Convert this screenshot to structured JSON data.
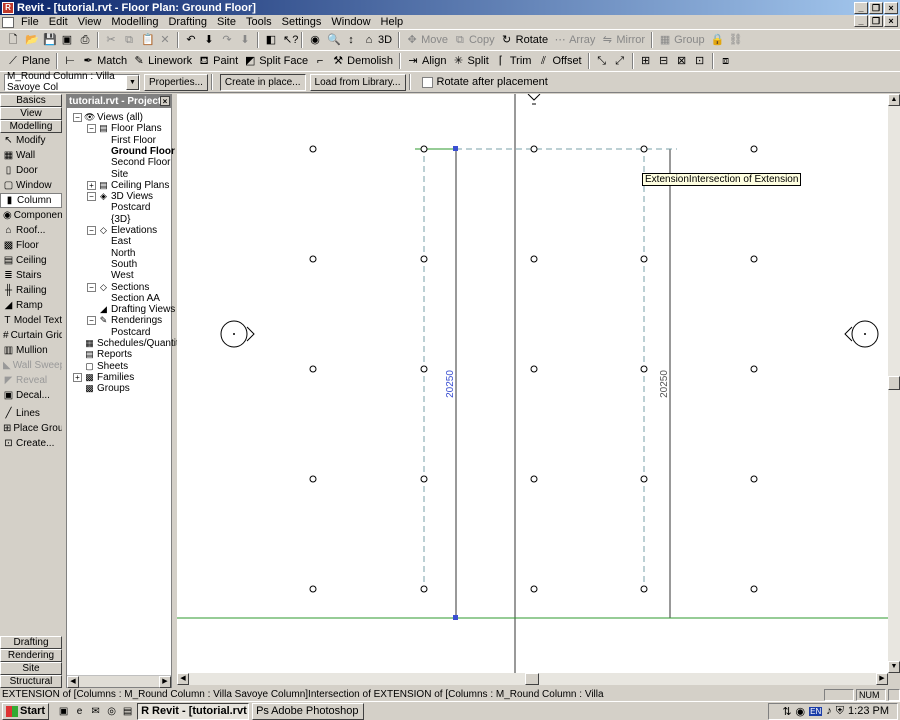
{
  "window": {
    "title": "Revit - [tutorial.rvt - Floor Plan: Ground Floor]",
    "min": "_",
    "max": "□",
    "close": "×",
    "restore": "❐"
  },
  "menu": [
    "File",
    "Edit",
    "View",
    "Modelling",
    "Drafting",
    "Site",
    "Tools",
    "Settings",
    "Window",
    "Help"
  ],
  "toolbar1": {
    "move": "Move",
    "copy": "Copy",
    "rotate": "Rotate",
    "array": "Array",
    "mirror": "Mirror",
    "group": "Group",
    "threed": "3D"
  },
  "toolbar2": {
    "plane": "Plane",
    "match": "Match",
    "linework": "Linework",
    "paint": "Paint",
    "split_face": "Split Face",
    "demolish": "Demolish",
    "align": "Align",
    "split": "Split",
    "trim": "Trim",
    "offset": "Offset"
  },
  "options_bar": {
    "type_selector": "M_Round Column : Villa Savoye Col",
    "properties": "Properties...",
    "create_in_place": "Create in place...",
    "load_from_library": "Load from Library...",
    "rotate_after_placement": "Rotate after placement"
  },
  "design_bar": {
    "tabs_top": [
      "Basics",
      "View",
      "Modelling"
    ],
    "items": [
      {
        "label": "Modify",
        "icon": "↖",
        "dim": false,
        "selected": false
      },
      {
        "label": "Wall",
        "icon": "▦",
        "dim": false,
        "selected": false
      },
      {
        "label": "Door",
        "icon": "▯",
        "dim": false,
        "selected": false
      },
      {
        "label": "Window",
        "icon": "▢",
        "dim": false,
        "selected": false
      },
      {
        "label": "Column",
        "icon": "▮",
        "dim": false,
        "selected": true
      },
      {
        "label": "Component",
        "icon": "◉",
        "dim": false,
        "selected": false
      },
      {
        "label": "Roof...",
        "icon": "⌂",
        "dim": false,
        "selected": false
      },
      {
        "label": "Floor",
        "icon": "▩",
        "dim": false,
        "selected": false
      },
      {
        "label": "Ceiling",
        "icon": "▤",
        "dim": false,
        "selected": false
      },
      {
        "label": "Stairs",
        "icon": "≣",
        "dim": false,
        "selected": false
      },
      {
        "label": "Railing",
        "icon": "╫",
        "dim": false,
        "selected": false
      },
      {
        "label": "Ramp",
        "icon": "◢",
        "dim": false,
        "selected": false
      },
      {
        "label": "Model Text",
        "icon": "T",
        "dim": false,
        "selected": false
      },
      {
        "label": "Curtain Grid",
        "icon": "#",
        "dim": false,
        "selected": false
      },
      {
        "label": "Mullion",
        "icon": "▥",
        "dim": false,
        "selected": false
      },
      {
        "label": "Wall Sweep",
        "icon": "◣",
        "dim": true,
        "selected": false
      },
      {
        "label": "Reveal",
        "icon": "◤",
        "dim": true,
        "selected": false
      },
      {
        "label": "Decal...",
        "icon": "▣",
        "dim": false,
        "selected": false
      },
      {
        "label": "Lines",
        "icon": "╱",
        "dim": false,
        "selected": false
      },
      {
        "label": "Place Group",
        "icon": "⊞",
        "dim": false,
        "selected": false
      },
      {
        "label": "Create...",
        "icon": "⊡",
        "dim": false,
        "selected": false
      }
    ],
    "tabs_bottom": [
      "Drafting",
      "Rendering",
      "Site",
      "Structural"
    ]
  },
  "project_browser": {
    "title": "tutorial.rvt - Project ...",
    "close": "×",
    "nodes": [
      {
        "label": "Views (all)",
        "level": 0,
        "pm": "−",
        "icon": "👁",
        "bold": false
      },
      {
        "label": "Floor Plans",
        "level": 1,
        "pm": "−",
        "icon": "▤",
        "bold": false
      },
      {
        "label": "First Floor",
        "level": 2,
        "pm": "",
        "icon": "",
        "bold": false
      },
      {
        "label": "Ground Floor",
        "level": 2,
        "pm": "",
        "icon": "",
        "bold": true
      },
      {
        "label": "Second Floor",
        "level": 2,
        "pm": "",
        "icon": "",
        "bold": false
      },
      {
        "label": "Site",
        "level": 2,
        "pm": "",
        "icon": "",
        "bold": false
      },
      {
        "label": "Ceiling Plans",
        "level": 1,
        "pm": "+",
        "icon": "▤",
        "bold": false
      },
      {
        "label": "3D Views",
        "level": 1,
        "pm": "−",
        "icon": "◈",
        "bold": false
      },
      {
        "label": "Postcard",
        "level": 2,
        "pm": "",
        "icon": "",
        "bold": false
      },
      {
        "label": "{3D}",
        "level": 2,
        "pm": "",
        "icon": "",
        "bold": false
      },
      {
        "label": "Elevations",
        "level": 1,
        "pm": "−",
        "icon": "◇",
        "bold": false
      },
      {
        "label": "East",
        "level": 2,
        "pm": "",
        "icon": "",
        "bold": false
      },
      {
        "label": "North",
        "level": 2,
        "pm": "",
        "icon": "",
        "bold": false
      },
      {
        "label": "South",
        "level": 2,
        "pm": "",
        "icon": "",
        "bold": false
      },
      {
        "label": "West",
        "level": 2,
        "pm": "",
        "icon": "",
        "bold": false
      },
      {
        "label": "Sections",
        "level": 1,
        "pm": "−",
        "icon": "◇",
        "bold": false
      },
      {
        "label": "Section AA",
        "level": 2,
        "pm": "",
        "icon": "",
        "bold": false
      },
      {
        "label": "Drafting Views",
        "level": 1,
        "pm": "",
        "icon": "◢",
        "bold": false
      },
      {
        "label": "Renderings",
        "level": 1,
        "pm": "−",
        "icon": "✎",
        "bold": false
      },
      {
        "label": "Postcard",
        "level": 2,
        "pm": "",
        "icon": "",
        "bold": false
      },
      {
        "label": "Schedules/Quantities",
        "level": 0,
        "pm": "",
        "icon": "▦",
        "bold": false
      },
      {
        "label": "Reports",
        "level": 0,
        "pm": "",
        "icon": "▤",
        "bold": false
      },
      {
        "label": "Sheets",
        "level": 0,
        "pm": "",
        "icon": "▢",
        "bold": false
      },
      {
        "label": "Families",
        "level": 0,
        "pm": "+",
        "icon": "▩",
        "bold": false
      },
      {
        "label": "Groups",
        "level": 0,
        "pm": "",
        "icon": "▩",
        "bold": false
      }
    ]
  },
  "canvas": {
    "tooltip": "ExtensionIntersection  of Extension",
    "dimension_left": "20250",
    "dimension_right": "20250",
    "colors": {
      "grid_green": "#2e9a2e",
      "dim_blue": "#3a4fd1",
      "dashed": "#7aa0a8"
    }
  },
  "status": {
    "text": "EXTENSION  of [Columns : M_Round Column : Villa Savoye Column]Intersection  of EXTENSION  of [Columns : M_Round Column : Villa",
    "num": "NUM"
  },
  "taskbar": {
    "start": "Start",
    "tasks": [
      {
        "label": "Revit - [tutorial.rvt ...",
        "active": true
      },
      {
        "label": "Adobe Photoshop",
        "active": false
      }
    ],
    "lang": "EN",
    "clock": "1:23 PM"
  }
}
